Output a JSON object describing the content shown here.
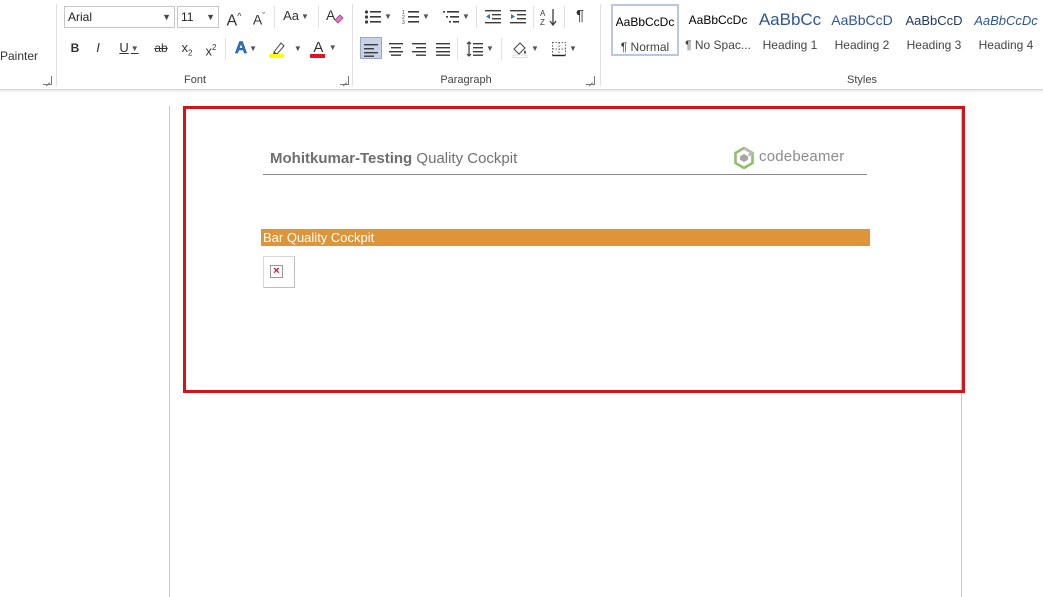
{
  "ribbon": {
    "clipboard": {
      "format_painter_label": "Painter"
    },
    "font": {
      "group_label": "Font",
      "font_name": "Arial",
      "font_size": "11",
      "grow_label": "A",
      "shrink_label": "A",
      "change_case_label": "Aa",
      "bold_label": "B",
      "italic_label": "I",
      "underline_label": "U",
      "strike_label": "ab",
      "subscript_label": "x",
      "subscript_suffix": "2",
      "superscript_label": "x",
      "superscript_suffix": "2",
      "text_effects_label": "A",
      "font_color_label": "A",
      "highlight_color": "#ffff00",
      "font_color": "#e81123"
    },
    "paragraph": {
      "group_label": "Paragraph",
      "pilcrow_label": "¶"
    },
    "styles": {
      "group_label": "Styles",
      "items": [
        {
          "sample": "AaBbCcDc",
          "name": "¶ Normal"
        },
        {
          "sample": "AaBbCcDc",
          "name": "¶ No Spac..."
        },
        {
          "sample": "AaBbCc",
          "name": "Heading 1"
        },
        {
          "sample": "AaBbCcD",
          "name": "Heading 2"
        },
        {
          "sample": "AaBbCcD",
          "name": "Heading 3"
        },
        {
          "sample": "AaBbCcDc",
          "name": "Heading 4"
        }
      ]
    }
  },
  "document": {
    "title_project": "Mohitkumar-Testing",
    "title_rest": "Quality Cockpit",
    "logo_text": "codebeamer",
    "section_title": "Bar Quality Cockpit",
    "broken_image_symbol": "×",
    "accent_color": "#de9439",
    "highlight_border_color": "#d2131a"
  }
}
